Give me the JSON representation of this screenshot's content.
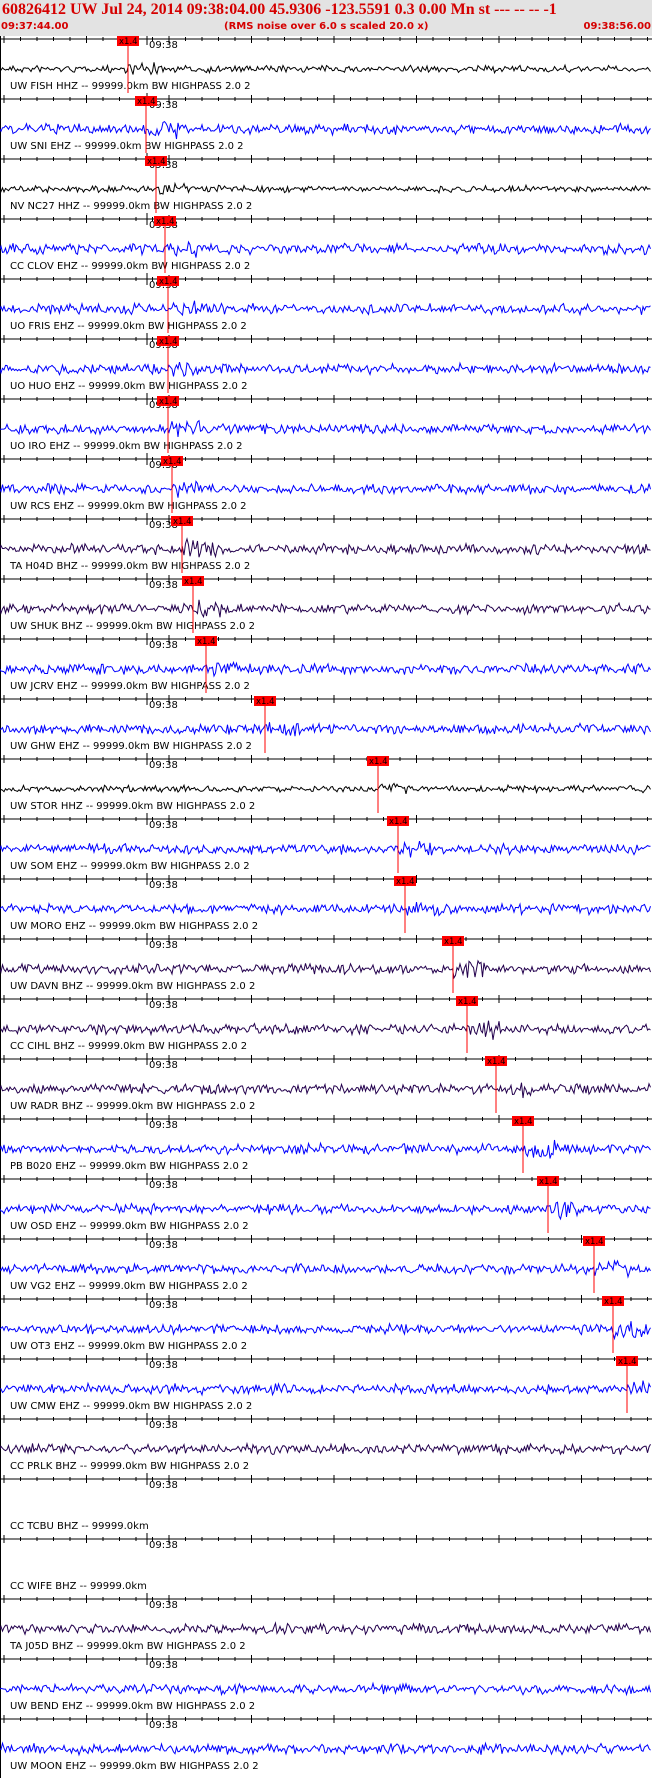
{
  "header": {
    "title": "60826412 UW Jul 24, 2014 09:38:04.00   45.9306 -123.5591  0.3 0.00 Mn st --- -- --  -1",
    "start_time": "09:37:44.00",
    "subtitle": "(RMS noise over 6.0 s scaled 20.0 x)",
    "end_time": "09:38:56.00"
  },
  "colors": {
    "header_bg": "#e3e3e3",
    "header_text": "#d50000",
    "pick": "#ff0000",
    "black": "#000000",
    "blue": "#0000ff",
    "navy": "#23004d"
  },
  "chart_data": {
    "type": "line",
    "title": "60826412 UW Jul 24, 2014 09:38:04.00   45.9306 -123.5591  0.3 0.00 Mn st --- -- --  -1",
    "subtitle": "(RMS noise over 6.0 s scaled 20.0 x)",
    "x_range": [
      "09:37:44.00",
      "09:38:56.00"
    ],
    "minute_label": "09:38",
    "pick_label": "x1.4",
    "traces": [
      {
        "label": "UW FISH HHZ -- 99999.0km BW  HIGHPASS  2.0  2",
        "color": "black",
        "pick": true
      },
      {
        "label": "UW SNI EHZ -- 99999.0km BW  HIGHPASS  2.0  2",
        "color": "blue",
        "pick": true
      },
      {
        "label": "NV NC27 HHZ -- 99999.0km BW  HIGHPASS  2.0  2",
        "color": "black",
        "pick": true
      },
      {
        "label": "CC CLOV EHZ -- 99999.0km BW  HIGHPASS  2.0  2",
        "color": "blue",
        "pick": true
      },
      {
        "label": "UO FRIS EHZ -- 99999.0km BW  HIGHPASS  2.0  2",
        "color": "blue",
        "pick": true
      },
      {
        "label": "UO HUO EHZ -- 99999.0km BW  HIGHPASS  2.0  2",
        "color": "blue",
        "pick": true
      },
      {
        "label": "UO IRO EHZ -- 99999.0km BW  HIGHPASS  2.0  2",
        "color": "blue",
        "pick": true
      },
      {
        "label": "UW RCS EHZ -- 99999.0km BW  HIGHPASS  2.0  2",
        "color": "blue",
        "pick": true
      },
      {
        "label": "TA H04D BHZ -- 99999.0km BW  HIGHPASS  2.0  2",
        "color": "navy",
        "pick": true
      },
      {
        "label": "UW SHUK BHZ -- 99999.0km BW  HIGHPASS  2.0  2",
        "color": "navy",
        "pick": true
      },
      {
        "label": "UW JCRV EHZ -- 99999.0km BW  HIGHPASS  2.0  2",
        "color": "blue",
        "pick": true
      },
      {
        "label": "UW GHW EHZ -- 99999.0km BW  HIGHPASS  2.0  2",
        "color": "blue",
        "pick": true
      },
      {
        "label": "UW STOR HHZ -- 99999.0km BW  HIGHPASS  2.0  2",
        "color": "black",
        "pick": true
      },
      {
        "label": "UW SOM EHZ -- 99999.0km BW  HIGHPASS  2.0  2",
        "color": "blue",
        "pick": true
      },
      {
        "label": "UW MORO EHZ -- 99999.0km BW  HIGHPASS  2.0  2",
        "color": "blue",
        "pick": true
      },
      {
        "label": "UW DAVN BHZ -- 99999.0km BW  HIGHPASS  2.0  2",
        "color": "navy",
        "pick": true
      },
      {
        "label": "CC CIHL BHZ -- 99999.0km BW  HIGHPASS  2.0  2",
        "color": "navy",
        "pick": true
      },
      {
        "label": "UW RADR BHZ -- 99999.0km BW  HIGHPASS  2.0  2",
        "color": "navy",
        "pick": true
      },
      {
        "label": "PB B020 EHZ -- 99999.0km BW  HIGHPASS  2.0  2",
        "color": "blue",
        "pick": true
      },
      {
        "label": "UW OSD EHZ -- 99999.0km BW  HIGHPASS  2.0  2",
        "color": "blue",
        "pick": true
      },
      {
        "label": "UW VG2 EHZ -- 99999.0km BW  HIGHPASS  2.0  2",
        "color": "blue",
        "pick": true
      },
      {
        "label": "UW OT3 EHZ -- 99999.0km BW  HIGHPASS  2.0  2",
        "color": "blue",
        "pick": true
      },
      {
        "label": "UW CMW EHZ -- 99999.0km BW  HIGHPASS  2.0  2",
        "color": "blue",
        "pick": true
      },
      {
        "label": "CC PRLK BHZ -- 99999.0km BW  HIGHPASS  2.0  2",
        "color": "navy",
        "pick": false
      },
      {
        "label": "CC TCBU BHZ -- 99999.0km",
        "color": "none",
        "pick": false
      },
      {
        "label": "CC WIFE BHZ -- 99999.0km",
        "color": "none",
        "pick": false
      },
      {
        "label": "TA J05D BHZ -- 99999.0km BW  HIGHPASS  2.0  2",
        "color": "navy",
        "pick": false
      },
      {
        "label": "UW BEND EHZ -- 99999.0km BW  HIGHPASS  2.0  2",
        "color": "blue",
        "pick": false
      },
      {
        "label": "UW MOON EHZ -- 99999.0km BW  HIGHPASS  2.0  2",
        "color": "blue",
        "pick": false
      }
    ]
  }
}
